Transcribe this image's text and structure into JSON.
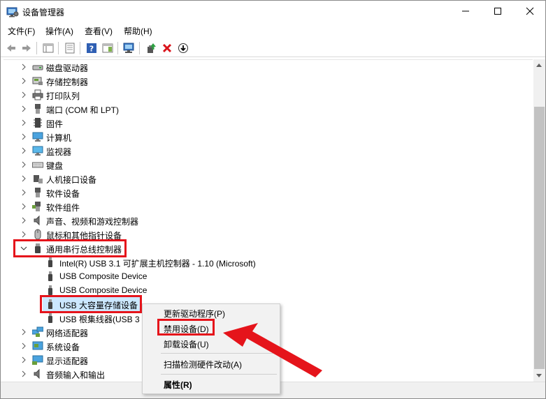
{
  "window": {
    "title": "设备管理器"
  },
  "menu": [
    "文件(F)",
    "操作(A)",
    "查看(V)",
    "帮助(H)"
  ],
  "tree": {
    "categories_top": [
      {
        "label": "磁盘驱动器",
        "icon": "disk-drive-icon"
      },
      {
        "label": "存储控制器",
        "icon": "storage-controller-icon"
      },
      {
        "label": "打印队列",
        "icon": "printer-icon"
      },
      {
        "label": "端口 (COM 和 LPT)",
        "icon": "port-icon"
      },
      {
        "label": "固件",
        "icon": "firmware-icon"
      },
      {
        "label": "计算机",
        "icon": "computer-icon"
      },
      {
        "label": "监视器",
        "icon": "monitor-icon"
      },
      {
        "label": "键盘",
        "icon": "keyboard-icon"
      },
      {
        "label": "人机接口设备",
        "icon": "hid-icon"
      },
      {
        "label": "软件设备",
        "icon": "software-device-icon"
      },
      {
        "label": "软件组件",
        "icon": "software-component-icon"
      },
      {
        "label": "声音、视频和游戏控制器",
        "icon": "speaker-icon"
      },
      {
        "label": "鼠标和其他指针设备",
        "icon": "mouse-icon"
      }
    ],
    "usb_category": {
      "label": "通用串行总线控制器",
      "icon": "usb-icon"
    },
    "usb_children": [
      "Intel(R) USB 3.1 可扩展主机控制器 - 1.10 (Microsoft)",
      "USB Composite Device",
      "USB Composite Device",
      "USB 大容量存储设备",
      "USB 根集线器(USB 3"
    ],
    "categories_bottom": [
      {
        "label": "网络适配器",
        "icon": "network-adapter-icon"
      },
      {
        "label": "系统设备",
        "icon": "system-device-icon"
      },
      {
        "label": "显示适配器",
        "icon": "display-adapter-icon"
      },
      {
        "label": "音频输入和输出",
        "icon": "audio-io-icon"
      }
    ]
  },
  "context_menu": {
    "update_driver": "更新驱动程序(P)",
    "disable_device": "禁用设备(D)",
    "uninstall_device": "卸载设备(U)",
    "scan_hardware": "扫描检测硬件改动(A)",
    "properties": "属性(R)"
  },
  "colors": {
    "highlight_red": "#e5141b",
    "selection": "#cce8ff",
    "arrow_red": "#e5141b"
  }
}
